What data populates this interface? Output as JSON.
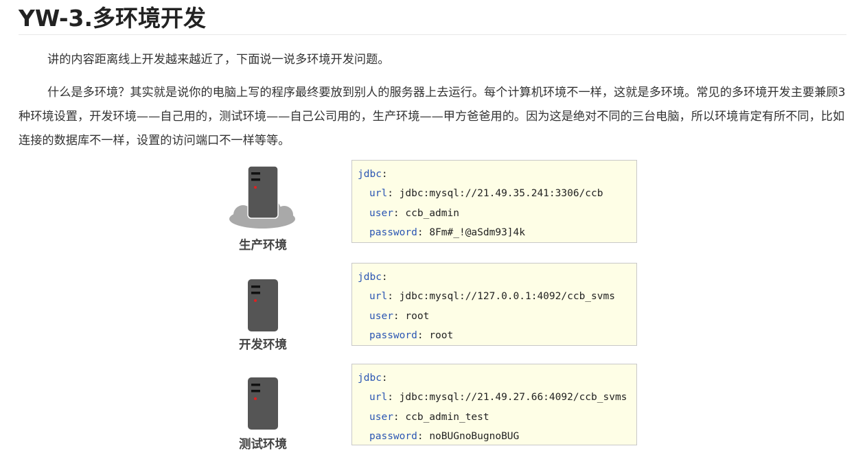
{
  "title": "YW-3.多环境开发",
  "paragraphs": [
    "讲的内容距离线上开发越来越近了，下面说一说多环境开发问题。",
    "什么是多环境？其实就是说你的电脑上写的程序最终要放到别人的服务器上去运行。每个计算机环境不一样，这就是多环境。常见的多环境开发主要兼顾3种环境设置，开发环境——自己用的，测试环境——自己公司用的，生产环境——甲方爸爸用的。因为这是绝对不同的三台电脑，所以环境肯定有所不同，比如连接的数据库不一样，设置的访问端口不一样等等。"
  ],
  "environments": [
    {
      "label": "生产环境",
      "icon": "server-cloud-icon",
      "config": {
        "root_key": "jdbc",
        "url_key": "url",
        "url": "jdbc:mysql://21.49.35.241:3306/ccb",
        "user_key": "user",
        "user": "ccb_admin",
        "password_key": "password",
        "password": "8Fm#_!@aSdm93]4k"
      }
    },
    {
      "label": "开发环境",
      "icon": "server-icon",
      "config": {
        "root_key": "jdbc",
        "url_key": "url",
        "url": "jdbc:mysql://127.0.0.1:4092/ccb_svms",
        "user_key": "user",
        "user": "root",
        "password_key": "password",
        "password": "root"
      }
    },
    {
      "label": "测试环境",
      "icon": "server-icon",
      "config": {
        "root_key": "jdbc",
        "url_key": "url",
        "url": "jdbc:mysql://21.49.27.66:4092/ccb_svms",
        "user_key": "user",
        "user": "ccb_admin_test",
        "password_key": "password",
        "password": "noBUGnoBugnoBUG"
      }
    }
  ],
  "colors": {
    "code_background": "#fefee6",
    "code_key": "#2a55b3",
    "server_body": "#555555",
    "server_led": "#e02020",
    "cloud": "#a9a9a9"
  }
}
